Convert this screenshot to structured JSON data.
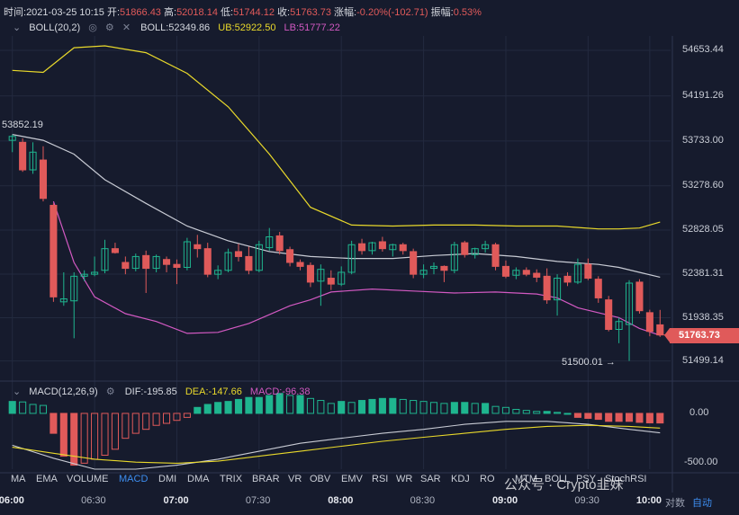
{
  "info": {
    "time_label": "时间:",
    "time_value": "2021-03-25 10:15",
    "open_label": "开:",
    "open_value": "51866.43",
    "high_label": "高:",
    "high_value": "52018.14",
    "low_label": "低:",
    "low_value": "51744.12",
    "close_label": "收:",
    "close_value": "51763.73",
    "change_label": "涨幅:",
    "change_value": "-0.20%(-102.71)",
    "amp_label": "振幅:",
    "amp_value": "0.53%"
  },
  "boll": {
    "name": "BOLL(20,2)",
    "mid": "BOLL:52349.86",
    "ub": "UB:52922.50",
    "lb": "LB:51777.22"
  },
  "macd": {
    "name": "MACD(12,26,9)",
    "dif": "DIF:-195.85",
    "dea": "DEA:-147.66",
    "macd": "MACD:-96.38"
  },
  "price_axis": [
    "54653.44",
    "54191.26",
    "53733.00",
    "53278.60",
    "52828.05",
    "52381.31",
    "51938.35",
    "51499.14"
  ],
  "macd_axis": [
    "0.00",
    "-500.00"
  ],
  "current_price": "51763.73",
  "high_marker": "53852.19",
  "low_marker": "51500.01 →",
  "indicators": [
    "MA",
    "EMA",
    "VOLUME",
    "MACD",
    "DMI",
    "DMA",
    "TRIX",
    "BRAR",
    "VR",
    "OBV",
    "EMV",
    "RSI",
    "WR",
    "SAR",
    "KDJ",
    "RO",
    "MTM",
    "BOLL",
    "PSY",
    "StochRSI"
  ],
  "active_indicator": "MACD",
  "time_axis": [
    {
      "label": "06:00",
      "major": true
    },
    {
      "label": "06:30",
      "major": false
    },
    {
      "label": "07:00",
      "major": true
    },
    {
      "label": "07:30",
      "major": false
    },
    {
      "label": "08:00",
      "major": true
    },
    {
      "label": "08:30",
      "major": false
    },
    {
      "label": "09:00",
      "major": true
    },
    {
      "label": "09:30",
      "major": false
    },
    {
      "label": "10:00",
      "major": true
    }
  ],
  "bottom_right": {
    "log": "对数",
    "auto": "自动"
  },
  "watermark": "公众号 · Crypto韭妹",
  "colors": {
    "up": "#1fb58f",
    "down": "#e05a5a",
    "ub": "#e9d92b",
    "mid": "#c8cbd4",
    "lb": "#d259c2",
    "bg": "#161b2d"
  },
  "chart_data": {
    "type": "candlestick",
    "interval": "15m",
    "ylim": [
      51350,
      54800
    ],
    "candles": [
      {
        "o": 53740,
        "h": 53800,
        "l": 53620,
        "c": 53780
      },
      {
        "o": 53720,
        "h": 53760,
        "l": 53420,
        "c": 53440
      },
      {
        "o": 53440,
        "h": 53720,
        "l": 53400,
        "c": 53620
      },
      {
        "o": 53540,
        "h": 53680,
        "l": 53120,
        "c": 53150
      },
      {
        "o": 53080,
        "h": 53100,
        "l": 52100,
        "c": 52150
      },
      {
        "o": 52100,
        "h": 52400,
        "l": 52060,
        "c": 52130
      },
      {
        "o": 52110,
        "h": 52400,
        "l": 51730,
        "c": 52360
      },
      {
        "o": 52360,
        "h": 52420,
        "l": 52310,
        "c": 52380
      },
      {
        "o": 52380,
        "h": 52560,
        "l": 52360,
        "c": 52400
      },
      {
        "o": 52420,
        "h": 52730,
        "l": 52390,
        "c": 52640
      },
      {
        "o": 52640,
        "h": 52700,
        "l": 52590,
        "c": 52600
      },
      {
        "o": 52500,
        "h": 52560,
        "l": 52380,
        "c": 52440
      },
      {
        "o": 52440,
        "h": 52590,
        "l": 52410,
        "c": 52560
      },
      {
        "o": 52570,
        "h": 52620,
        "l": 52190,
        "c": 52440
      },
      {
        "o": 52440,
        "h": 52580,
        "l": 52400,
        "c": 52560
      },
      {
        "o": 52530,
        "h": 52560,
        "l": 52400,
        "c": 52480
      },
      {
        "o": 52480,
        "h": 52530,
        "l": 52280,
        "c": 52450
      },
      {
        "o": 52450,
        "h": 52750,
        "l": 52420,
        "c": 52710
      },
      {
        "o": 52680,
        "h": 52780,
        "l": 52550,
        "c": 52640
      },
      {
        "o": 52640,
        "h": 52700,
        "l": 52350,
        "c": 52380
      },
      {
        "o": 52380,
        "h": 52470,
        "l": 52330,
        "c": 52420
      },
      {
        "o": 52420,
        "h": 52640,
        "l": 52400,
        "c": 52600
      },
      {
        "o": 52610,
        "h": 52690,
        "l": 52510,
        "c": 52560
      },
      {
        "o": 52560,
        "h": 52660,
        "l": 52380,
        "c": 52420
      },
      {
        "o": 52420,
        "h": 52720,
        "l": 52400,
        "c": 52680
      },
      {
        "o": 52650,
        "h": 52850,
        "l": 52620,
        "c": 52760
      },
      {
        "o": 52770,
        "h": 52810,
        "l": 52580,
        "c": 52620
      },
      {
        "o": 52630,
        "h": 52660,
        "l": 52460,
        "c": 52500
      },
      {
        "o": 52500,
        "h": 52530,
        "l": 52420,
        "c": 52460
      },
      {
        "o": 52470,
        "h": 52500,
        "l": 52250,
        "c": 52300
      },
      {
        "o": 52310,
        "h": 52480,
        "l": 52060,
        "c": 52430
      },
      {
        "o": 52340,
        "h": 52420,
        "l": 52220,
        "c": 52280
      },
      {
        "o": 52280,
        "h": 52460,
        "l": 52260,
        "c": 52400
      },
      {
        "o": 52400,
        "h": 52720,
        "l": 52380,
        "c": 52680
      },
      {
        "o": 52690,
        "h": 52740,
        "l": 52580,
        "c": 52620
      },
      {
        "o": 52620,
        "h": 52710,
        "l": 52580,
        "c": 52700
      },
      {
        "o": 52710,
        "h": 52760,
        "l": 52610,
        "c": 52640
      },
      {
        "o": 52630,
        "h": 52690,
        "l": 52560,
        "c": 52680
      },
      {
        "o": 52680,
        "h": 52700,
        "l": 52580,
        "c": 52620
      },
      {
        "o": 52610,
        "h": 52640,
        "l": 52340,
        "c": 52380
      },
      {
        "o": 52380,
        "h": 52480,
        "l": 52340,
        "c": 52420
      },
      {
        "o": 52440,
        "h": 52500,
        "l": 52380,
        "c": 52460
      },
      {
        "o": 52460,
        "h": 52470,
        "l": 52300,
        "c": 52420
      },
      {
        "o": 52420,
        "h": 52710,
        "l": 52390,
        "c": 52680
      },
      {
        "o": 52700,
        "h": 52720,
        "l": 52550,
        "c": 52580
      },
      {
        "o": 52580,
        "h": 52650,
        "l": 52540,
        "c": 52640
      },
      {
        "o": 52640,
        "h": 52720,
        "l": 52600,
        "c": 52680
      },
      {
        "o": 52680,
        "h": 52700,
        "l": 52420,
        "c": 52460
      },
      {
        "o": 52460,
        "h": 52520,
        "l": 52340,
        "c": 52360
      },
      {
        "o": 52370,
        "h": 52450,
        "l": 52330,
        "c": 52420
      },
      {
        "o": 52420,
        "h": 52450,
        "l": 52360,
        "c": 52380
      },
      {
        "o": 52390,
        "h": 52430,
        "l": 52300,
        "c": 52350
      },
      {
        "o": 52360,
        "h": 52440,
        "l": 52080,
        "c": 52120
      },
      {
        "o": 52120,
        "h": 52380,
        "l": 51960,
        "c": 52340
      },
      {
        "o": 52360,
        "h": 52400,
        "l": 52260,
        "c": 52300
      },
      {
        "o": 52300,
        "h": 52540,
        "l": 52280,
        "c": 52480
      },
      {
        "o": 52480,
        "h": 52540,
        "l": 52320,
        "c": 52340
      },
      {
        "o": 52330,
        "h": 52360,
        "l": 52090,
        "c": 52140
      },
      {
        "o": 52120,
        "h": 52160,
        "l": 51800,
        "c": 51820
      },
      {
        "o": 51820,
        "h": 51940,
        "l": 51680,
        "c": 51900
      },
      {
        "o": 51870,
        "h": 52320,
        "l": 51500,
        "c": 52290
      },
      {
        "o": 52300,
        "h": 52330,
        "l": 51980,
        "c": 52010
      },
      {
        "o": 51990,
        "h": 52020,
        "l": 51750,
        "c": 51800
      },
      {
        "o": 51866.43,
        "h": 52018.14,
        "l": 51744.12,
        "c": 51763.73
      }
    ],
    "ub": [
      [
        0,
        54450
      ],
      [
        3,
        54430
      ],
      [
        6,
        54680
      ],
      [
        9,
        54700
      ],
      [
        13,
        54630
      ],
      [
        17,
        54420
      ],
      [
        21,
        54080
      ],
      [
        25,
        53600
      ],
      [
        29,
        53060
      ],
      [
        33,
        52880
      ],
      [
        37,
        52870
      ],
      [
        41,
        52880
      ],
      [
        45,
        52880
      ],
      [
        49,
        52870
      ],
      [
        53,
        52870
      ],
      [
        57,
        52840
      ],
      [
        59,
        52840
      ],
      [
        61,
        52850
      ],
      [
        63,
        52910
      ]
    ],
    "mid": [
      [
        0,
        53800
      ],
      [
        3,
        53740
      ],
      [
        6,
        53600
      ],
      [
        9,
        53340
      ],
      [
        13,
        53100
      ],
      [
        17,
        52870
      ],
      [
        21,
        52720
      ],
      [
        25,
        52610
      ],
      [
        29,
        52560
      ],
      [
        33,
        52540
      ],
      [
        37,
        52540
      ],
      [
        41,
        52570
      ],
      [
        45,
        52590
      ],
      [
        49,
        52560
      ],
      [
        53,
        52510
      ],
      [
        57,
        52480
      ],
      [
        59,
        52450
      ],
      [
        61,
        52400
      ],
      [
        63,
        52350
      ]
    ],
    "lb": [
      [
        4,
        53120
      ],
      [
        6,
        52500
      ],
      [
        8,
        52150
      ],
      [
        11,
        51980
      ],
      [
        14,
        51900
      ],
      [
        17,
        51780
      ],
      [
        20,
        51790
      ],
      [
        23,
        51880
      ],
      [
        27,
        52060
      ],
      [
        29,
        52120
      ],
      [
        31,
        52200
      ],
      [
        35,
        52230
      ],
      [
        39,
        52210
      ],
      [
        43,
        52190
      ],
      [
        47,
        52200
      ],
      [
        51,
        52180
      ],
      [
        53,
        52140
      ],
      [
        55,
        52040
      ],
      [
        59,
        51940
      ],
      [
        61,
        51830
      ],
      [
        63,
        51760
      ]
    ],
    "macd_histogram": [
      120,
      115,
      90,
      80,
      -200,
      -430,
      -520,
      -500,
      -460,
      -420,
      -360,
      -250,
      -200,
      -160,
      -120,
      -100,
      -70,
      -40,
      60,
      90,
      110,
      120,
      140,
      160,
      160,
      180,
      200,
      180,
      180,
      150,
      130,
      100,
      120,
      110,
      130,
      140,
      150,
      150,
      140,
      130,
      120,
      110,
      100,
      110,
      110,
      100,
      100,
      70,
      60,
      40,
      30,
      20,
      20,
      10,
      0,
      -40,
      -50,
      -60,
      -80,
      -80,
      -80,
      -90,
      -95,
      -96.38
    ],
    "macd_dif": [
      [
        0,
        -320
      ],
      [
        4,
        -450
      ],
      [
        8,
        -560
      ],
      [
        12,
        -560
      ],
      [
        16,
        -520
      ],
      [
        20,
        -460
      ],
      [
        24,
        -380
      ],
      [
        28,
        -300
      ],
      [
        32,
        -250
      ],
      [
        36,
        -200
      ],
      [
        40,
        -160
      ],
      [
        44,
        -110
      ],
      [
        48,
        -80
      ],
      [
        52,
        -80
      ],
      [
        56,
        -110
      ],
      [
        60,
        -160
      ],
      [
        63,
        -195.85
      ]
    ],
    "macd_dea": [
      [
        0,
        -340
      ],
      [
        4,
        -400
      ],
      [
        8,
        -460
      ],
      [
        12,
        -490
      ],
      [
        16,
        -500
      ],
      [
        20,
        -480
      ],
      [
        24,
        -430
      ],
      [
        28,
        -380
      ],
      [
        32,
        -330
      ],
      [
        36,
        -280
      ],
      [
        40,
        -240
      ],
      [
        44,
        -200
      ],
      [
        48,
        -160
      ],
      [
        52,
        -130
      ],
      [
        56,
        -120
      ],
      [
        60,
        -130
      ],
      [
        63,
        -147.66
      ]
    ],
    "macd_ylim": [
      -560,
      180
    ]
  }
}
